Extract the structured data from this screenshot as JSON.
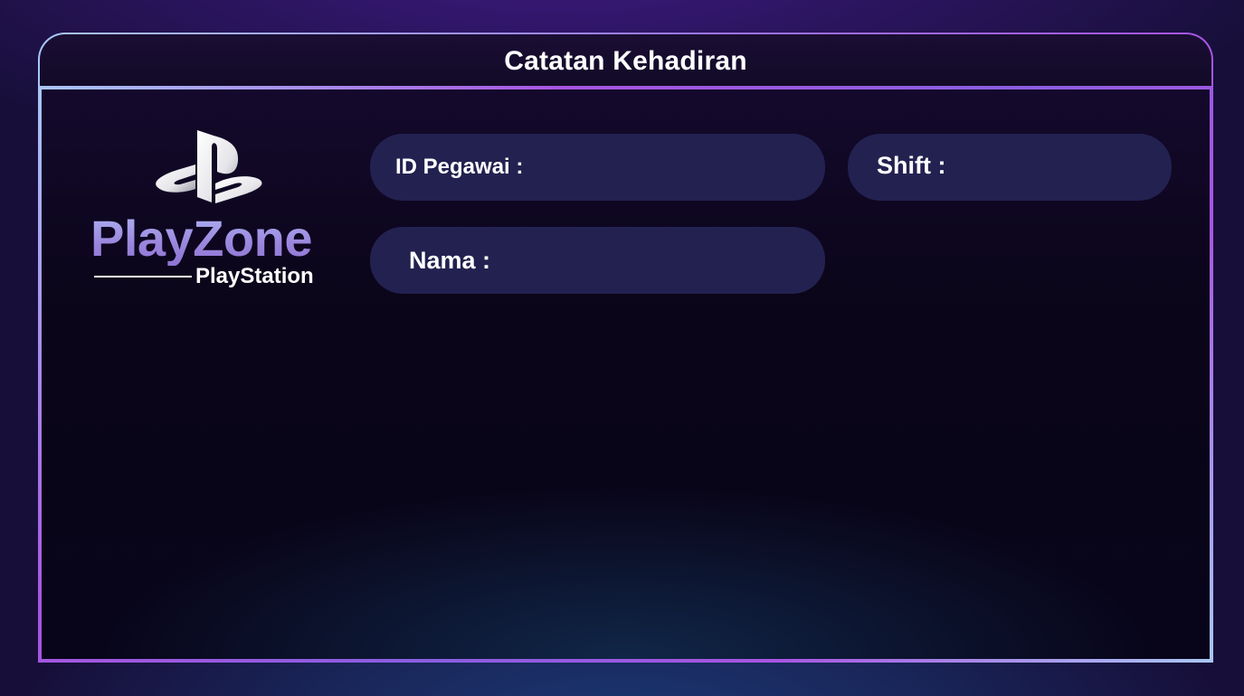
{
  "header": {
    "title": "Catatan Kehadiran"
  },
  "logo": {
    "icon": "playstation-logo-icon",
    "brand": "PlayZone",
    "sub": "PlayStation"
  },
  "form": {
    "id_label": "ID Pegawai :",
    "shift_label": "Shift :",
    "name_label": "Nama :"
  },
  "colors": {
    "field_bg": "#232150",
    "border_start": "#a9c7f7",
    "border_end": "#a855e0",
    "brand_text": "#9a86dd"
  }
}
